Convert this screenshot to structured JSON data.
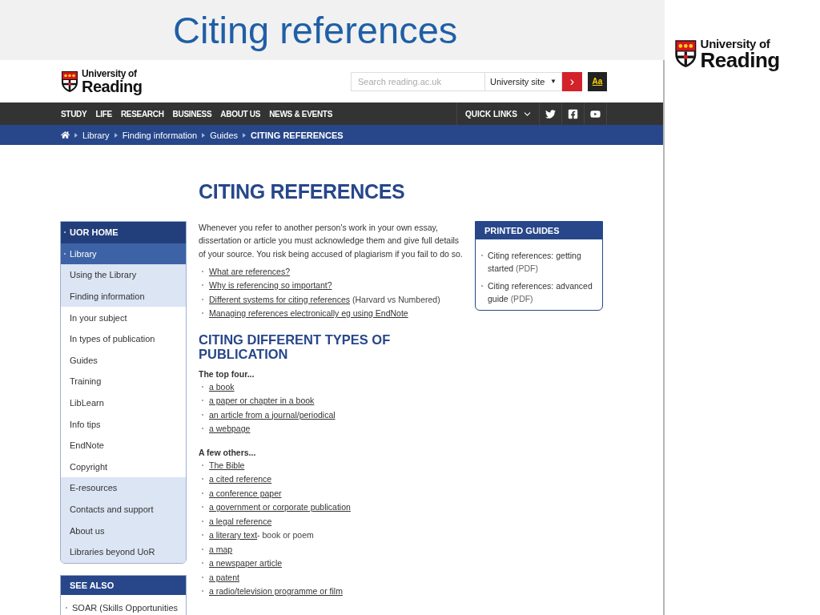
{
  "slide_title": "Citing references",
  "slide_logo": {
    "line1": "University of",
    "line2": "Reading"
  },
  "header": {
    "logo": {
      "line1": "University of",
      "line2": "Reading"
    },
    "search": {
      "placeholder": "Search reading.ac.uk"
    },
    "scope": "University site",
    "scope_caret": "▼",
    "go": "›",
    "text_size": "Aa"
  },
  "nav": {
    "items": [
      "STUDY",
      "LIFE",
      "RESEARCH",
      "BUSINESS",
      "ABOUT US",
      "NEWS & EVENTS"
    ],
    "quick_links": "QUICK LINKS"
  },
  "breadcrumb": [
    {
      "label": "Library",
      "current": false
    },
    {
      "label": "Finding information",
      "current": false
    },
    {
      "label": "Guides",
      "current": false
    },
    {
      "label": "CITING REFERENCES",
      "current": true
    }
  ],
  "heading": "CITING REFERENCES",
  "sidebar": [
    {
      "label": "UOR HOME",
      "children": [
        {
          "label": "Library",
          "children": [
            {
              "label": "Using the Library"
            },
            {
              "label": "Finding information",
              "children": [
                {
                  "label": "In your subject"
                },
                {
                  "label": "In types of publication"
                },
                {
                  "label": "Guides"
                },
                {
                  "label": "Training"
                },
                {
                  "label": "LibLearn"
                },
                {
                  "label": "Info tips"
                },
                {
                  "label": "EndNote"
                },
                {
                  "label": "Copyright"
                }
              ]
            },
            {
              "label": "E-resources"
            },
            {
              "label": "Contacts and support"
            },
            {
              "label": "About us"
            },
            {
              "label": "Libraries beyond UoR"
            }
          ]
        }
      ]
    }
  ],
  "see_also": {
    "title": "SEE ALSO",
    "items": [
      "SOAR (Skills Opportunities"
    ]
  },
  "intro": "Whenever you refer to another person's work in your own essay, dissertation or article you must acknowledge them and give full details of your source. You risk being accused of plagiarism if you fail to do so.",
  "intro_links": [
    {
      "link": "What are references?"
    },
    {
      "link": "Why is referencing so important?"
    },
    {
      "link": "Different systems for citing references",
      "note": " (Harvard vs Numbered)"
    },
    {
      "link": "Managing references electronically eg using EndNote"
    }
  ],
  "subheading": "CITING DIFFERENT TYPES OF PUBLICATION",
  "groups": [
    {
      "title": "The top four...",
      "links": [
        {
          "link": "a book"
        },
        {
          "link": "a paper or chapter in a book"
        },
        {
          "link": "an article from a journal/periodical"
        },
        {
          "link": "a webpage"
        }
      ]
    },
    {
      "title": "A few others...",
      "links": [
        {
          "link": "The Bible"
        },
        {
          "link": "a cited reference"
        },
        {
          "link": "a conference paper"
        },
        {
          "link": "a government or corporate publication"
        },
        {
          "link": "a legal reference"
        },
        {
          "link": "a literary text",
          "note": "- book or poem"
        },
        {
          "link": "a map"
        },
        {
          "link": "a newspaper article"
        },
        {
          "link": "a patent"
        },
        {
          "link": "a radio/television programme or film"
        }
      ]
    }
  ],
  "printed_guides": {
    "title": "PRINTED GUIDES",
    "items": [
      {
        "text": "Citing references: getting started",
        "note": "(PDF)"
      },
      {
        "text": "Citing references: advanced guide",
        "note": "(PDF)"
      }
    ]
  }
}
